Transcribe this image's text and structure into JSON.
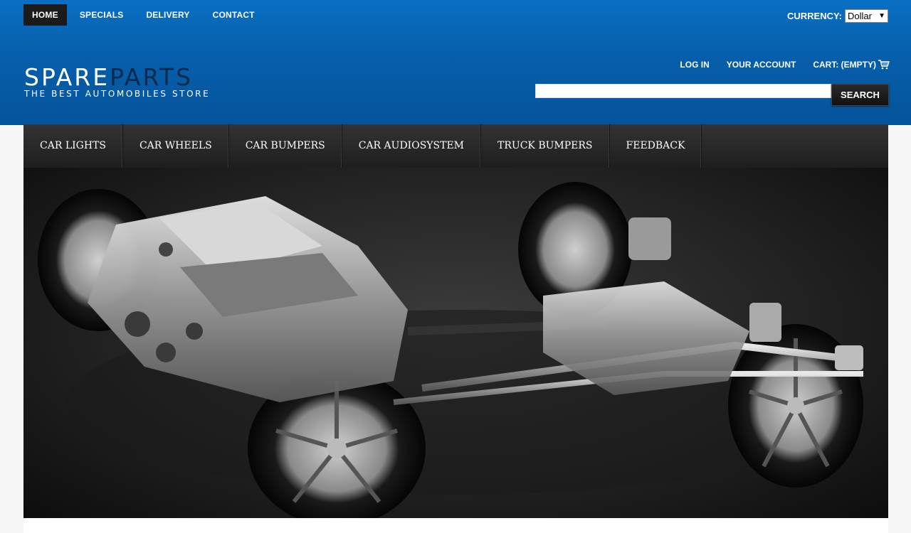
{
  "top_nav": {
    "items": [
      {
        "label": "HOME",
        "active": true
      },
      {
        "label": "SPECIALS"
      },
      {
        "label": "DELIVERY"
      },
      {
        "label": "CONTACT"
      }
    ]
  },
  "currency": {
    "label": "CURRENCY:",
    "selected": "Dollar"
  },
  "logo": {
    "main_part1": "SPARE",
    "main_part2": "PARTS",
    "tagline": "THE BEST AUTOMOBILES STORE"
  },
  "user_nav": {
    "login": "LOG IN",
    "account": "YOUR ACCOUNT",
    "cart": "CART: (EMPTY)"
  },
  "search": {
    "value": "",
    "button": "SEARCH"
  },
  "category_nav": {
    "items": [
      "CAR LIGHTS",
      "CAR WHEELS",
      "CAR BUMPERS",
      "CAR AUDIOSYSTEM",
      "TRUCK BUMPERS",
      "FEEDBACK"
    ]
  },
  "colors": {
    "header_blue": "#0760ad",
    "nav_dark": "#2a2a2a",
    "logo_dark": "#0b2a4e"
  },
  "icons": {
    "cart": "shopping-cart-icon"
  }
}
